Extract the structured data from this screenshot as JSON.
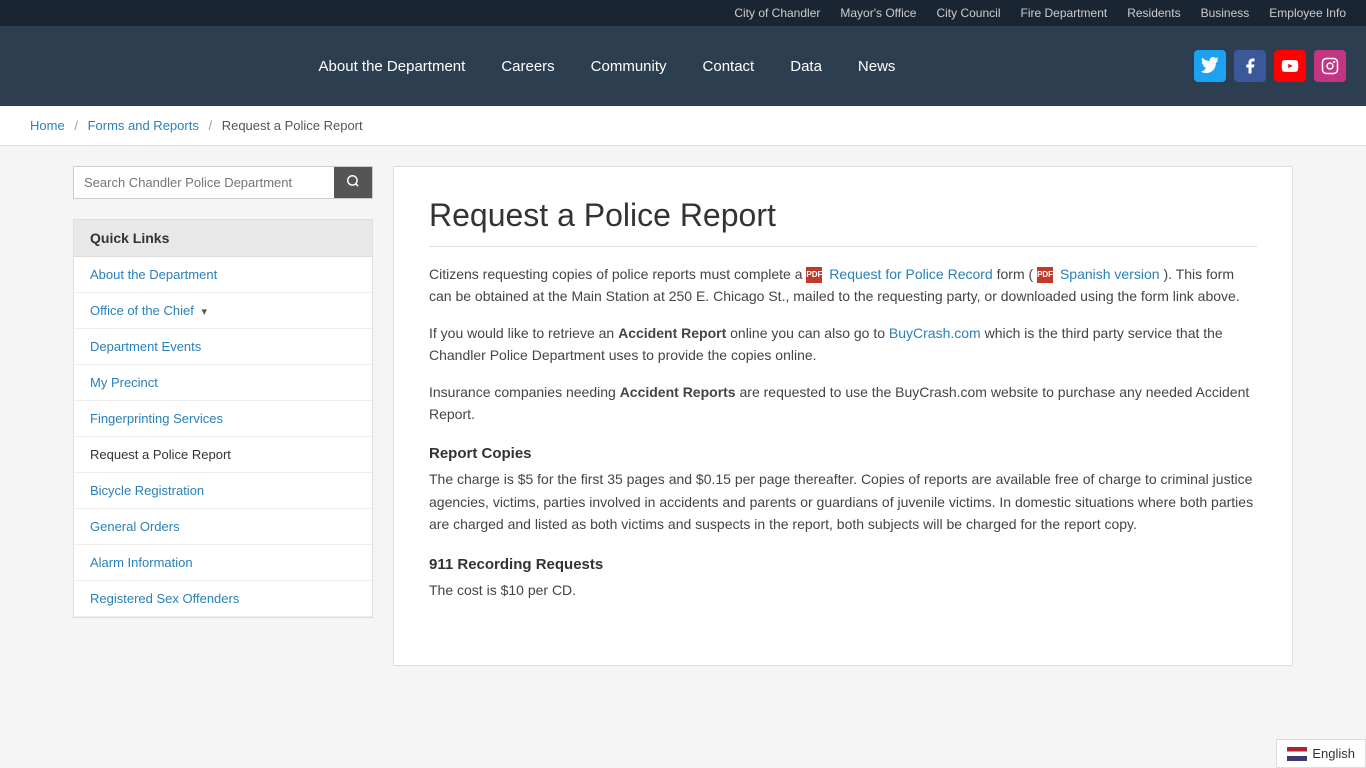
{
  "topbar": {
    "links": [
      {
        "label": "City of Chandler",
        "name": "city-of-chandler-link"
      },
      {
        "label": "Mayor's Office",
        "name": "mayors-office-link"
      },
      {
        "label": "City Council",
        "name": "city-council-link"
      },
      {
        "label": "Fire Department",
        "name": "fire-department-link"
      },
      {
        "label": "Residents",
        "name": "residents-link"
      },
      {
        "label": "Business",
        "name": "business-link"
      },
      {
        "label": "Employee Info",
        "name": "employee-info-link"
      }
    ]
  },
  "nav": {
    "links": [
      {
        "label": "About the Department",
        "name": "nav-about"
      },
      {
        "label": "Careers",
        "name": "nav-careers"
      },
      {
        "label": "Community",
        "name": "nav-community"
      },
      {
        "label": "Contact",
        "name": "nav-contact"
      },
      {
        "label": "Data",
        "name": "nav-data"
      },
      {
        "label": "News",
        "name": "nav-news"
      }
    ],
    "social": {
      "twitter_label": "🐦",
      "facebook_label": "f",
      "youtube_label": "▶",
      "instagram_label": "📷"
    }
  },
  "breadcrumb": {
    "home": "Home",
    "forms": "Forms and Reports",
    "current": "Request a Police Report"
  },
  "sidebar": {
    "search_placeholder": "Search Chandler Police Department",
    "search_button": "🔍",
    "quick_links_title": "Quick Links",
    "links": [
      {
        "label": "About the Department",
        "name": "sidebar-about",
        "active": false,
        "has_dropdown": false
      },
      {
        "label": "Office of the Chief",
        "name": "sidebar-chief",
        "active": false,
        "has_dropdown": true
      },
      {
        "label": "Department Events",
        "name": "sidebar-events",
        "active": false,
        "has_dropdown": false
      },
      {
        "label": "My Precinct",
        "name": "sidebar-precinct",
        "active": false,
        "has_dropdown": false
      },
      {
        "label": "Fingerprinting Services",
        "name": "sidebar-fingerprinting",
        "active": false,
        "has_dropdown": false
      },
      {
        "label": "Request a Police Report",
        "name": "sidebar-police-report",
        "active": true,
        "has_dropdown": false
      },
      {
        "label": "Bicycle Registration",
        "name": "sidebar-bicycle",
        "active": false,
        "has_dropdown": false
      },
      {
        "label": "General Orders",
        "name": "sidebar-general-orders",
        "active": false,
        "has_dropdown": false
      },
      {
        "label": "Alarm Information",
        "name": "sidebar-alarm",
        "active": false,
        "has_dropdown": false
      },
      {
        "label": "Registered Sex Offenders",
        "name": "sidebar-sex-offenders",
        "active": false,
        "has_dropdown": false
      }
    ]
  },
  "main": {
    "page_title": "Request a Police Report",
    "intro": "Citizens requesting copies of police reports must complete a",
    "form_link": "Request for Police Record",
    "form_text": "form (",
    "spanish_link": "Spanish version",
    "form_text2": "). This form can be obtained at the Main Station at 250 E. Chicago St., mailed to the requesting party, or downloaded using the form link above.",
    "accident_para1_prefix": "If you would like to retrieve an",
    "accident_bold1": "Accident Report",
    "accident_para1_mid": "online you can also go to",
    "accident_link": "BuyCrash.com",
    "accident_para1_suffix": "which is the third party service that the Chandler Police Department uses to provide the copies online.",
    "accident_para2_prefix": "Insurance companies needing",
    "accident_bold2": "Accident Reports",
    "accident_para2_suffix": "are requested to use the BuyCrash.com website to purchase any needed Accident Report.",
    "report_copies_title": "Report Copies",
    "report_copies_text": "The charge is $5 for the first 35 pages and $0.15 per page thereafter. Copies of reports are available free of charge to criminal justice agencies, victims, parties involved in accidents and parents or guardians of juvenile victims. In domestic situations where both parties are charged and listed as both victims and suspects in the report, both subjects will be charged for the report copy.",
    "recording_title": "911 Recording Requests",
    "recording_text": "The cost is $10 per CD."
  },
  "language": {
    "current": "English",
    "flag_text": "en"
  }
}
